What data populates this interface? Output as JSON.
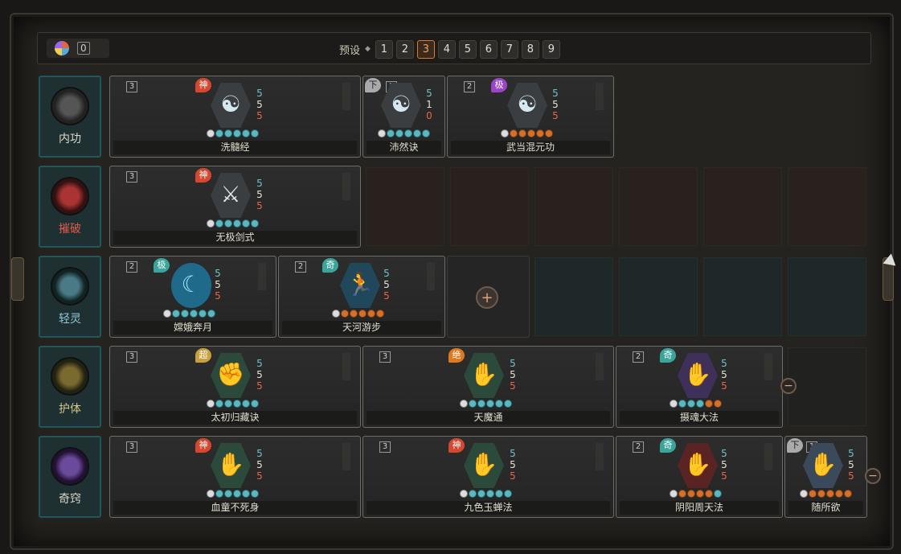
{
  "resources": {
    "count": "0"
  },
  "presets": {
    "label": "预设",
    "active": "3",
    "items": [
      "1",
      "2",
      "3",
      "4",
      "5",
      "6",
      "7",
      "8",
      "9"
    ]
  },
  "rows": [
    {
      "label": "内功"
    },
    {
      "label": "摧破"
    },
    {
      "label": "轻灵"
    },
    {
      "label": "护体"
    },
    {
      "label": "奇窍"
    }
  ],
  "cards": {
    "xisui": {
      "tier": "3",
      "badge": "神",
      "name": "洗髓经",
      "s1": "5",
      "s2": "5",
      "s3": "5"
    },
    "peiran": {
      "tier": "1",
      "badge": "下",
      "name": "沛然诀",
      "s1": "5",
      "s2": "1",
      "s3": "0"
    },
    "wudang": {
      "tier": "2",
      "badge": "极",
      "name": "武当混元功",
      "s1": "5",
      "s2": "5",
      "s3": "5"
    },
    "wuji": {
      "tier": "3",
      "badge": "神",
      "name": "无极剑式",
      "s1": "5",
      "s2": "5",
      "s3": "5"
    },
    "change": {
      "tier": "2",
      "badge": "极",
      "name": "嫦娥奔月",
      "s1": "5",
      "s2": "5",
      "s3": "5"
    },
    "tianhe": {
      "tier": "2",
      "badge": "奇",
      "name": "天河游步",
      "s1": "5",
      "s2": "5",
      "s3": "5"
    },
    "taichu": {
      "tier": "3",
      "badge": "超",
      "name": "太初归藏诀",
      "s1": "5",
      "s2": "5",
      "s3": "5"
    },
    "tianmo": {
      "tier": "3",
      "badge": "绝",
      "name": "天魔通",
      "s1": "5",
      "s2": "5",
      "s3": "5"
    },
    "shehun": {
      "tier": "2",
      "badge": "奇",
      "name": "摄魂大法",
      "s1": "5",
      "s2": "5",
      "s3": "5"
    },
    "xuetong": {
      "tier": "3",
      "badge": "神",
      "name": "血童不死身",
      "s1": "5",
      "s2": "5",
      "s3": "5"
    },
    "jiuse": {
      "tier": "3",
      "badge": "神",
      "name": "九色玉蝉法",
      "s1": "5",
      "s2": "5",
      "s3": "5"
    },
    "yinyang": {
      "tier": "2",
      "badge": "奇",
      "name": "阴阳周天法",
      "s1": "5",
      "s2": "5",
      "s3": "5"
    },
    "suisuo": {
      "tier": "1",
      "badge": "下",
      "name": "随所欲",
      "s1": "5",
      "s2": "5",
      "s3": "5"
    }
  },
  "icons": {
    "add": "+",
    "remove": "−"
  },
  "colors": {
    "accent": "#e07a2c",
    "teal": "#5ab9c0",
    "red": "#d4482e"
  }
}
